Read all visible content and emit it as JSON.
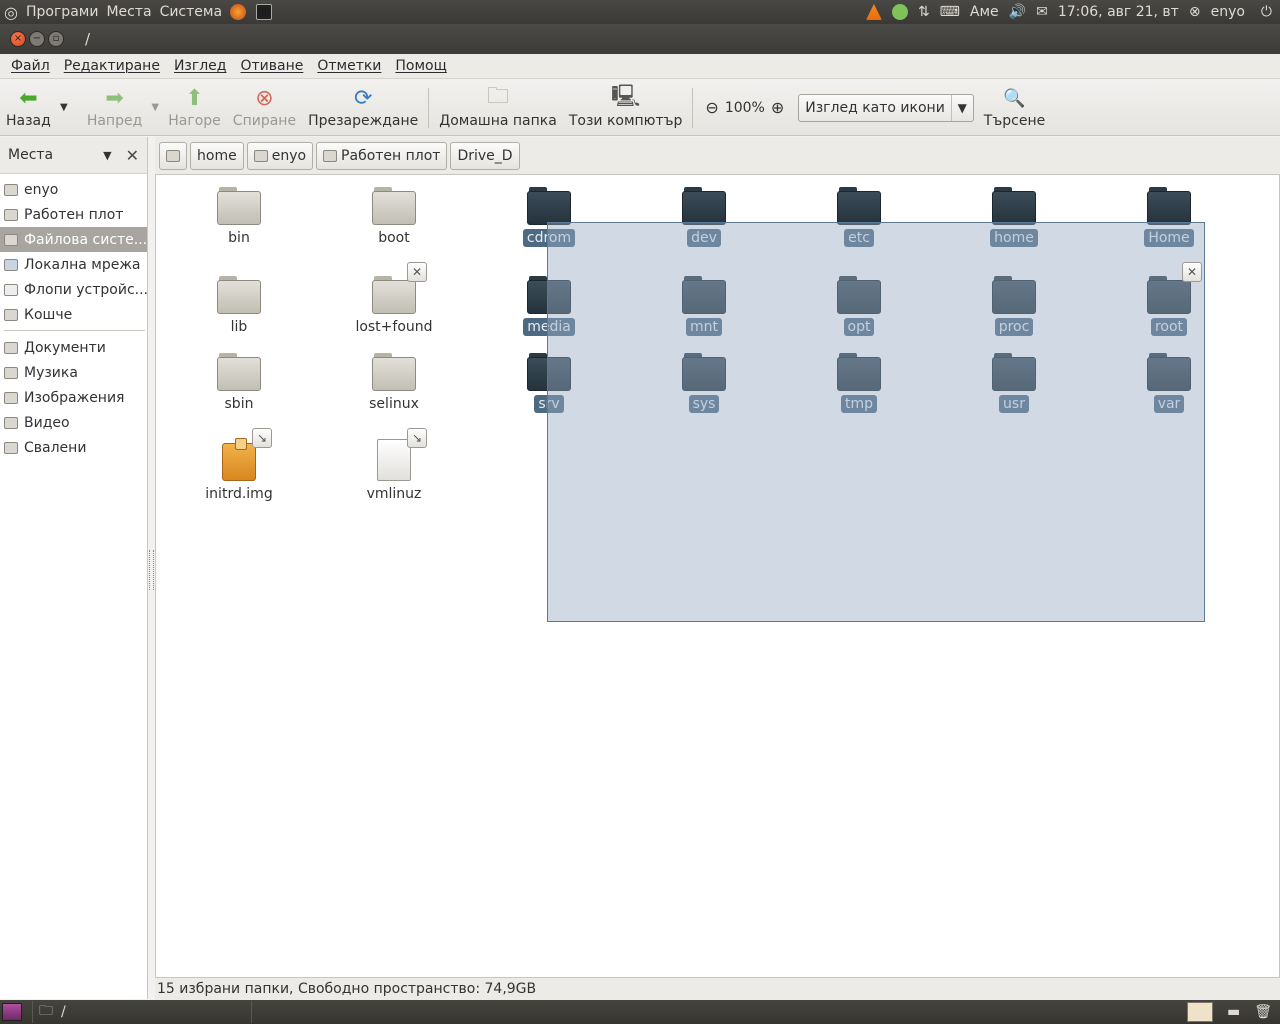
{
  "top_panel": {
    "menus": [
      "Програми",
      "Места",
      "Система"
    ],
    "keyboard": "Аме",
    "clock": "17:06, авг 21, вт",
    "user": "enyo"
  },
  "window": {
    "title": "/"
  },
  "menubar": [
    "Файл",
    "Редактиране",
    "Изглед",
    "Отиване",
    "Отметки",
    "Помощ"
  ],
  "toolbar": {
    "back": "Назад",
    "forward": "Напред",
    "up": "Нагоре",
    "stop": "Спиране",
    "reload": "Презареждане",
    "home": "Домашна папка",
    "computer": "Този компютър",
    "zoom": "100%",
    "view_mode": "Изглед като икони",
    "search": "Търсене"
  },
  "sidebar": {
    "header": "Места",
    "items": [
      "enyo",
      "Работен плот",
      "Файлова систе...",
      "Локална мрежа",
      "Флопи устройс...",
      "Кошче"
    ],
    "bookmarks": [
      "Документи",
      "Музика",
      "Изображения",
      "Видео",
      "Свалени"
    ]
  },
  "pathbar": [
    "home",
    "enyo",
    "Работен плот",
    "Drive_D"
  ],
  "files": {
    "unselected": [
      "bin",
      "boot",
      "lib",
      "lost+found",
      "sbin",
      "selinux",
      "initrd.img",
      "vmlinuz"
    ],
    "selected": [
      "cdrom",
      "dev",
      "etc",
      "home",
      "Home",
      "media",
      "mnt",
      "opt",
      "proc",
      "root",
      "srv",
      "sys",
      "tmp",
      "usr",
      "var"
    ]
  },
  "status": "15 избрани папки, Свободно пространство: 74,9GB",
  "bottom_panel": {
    "task": "/"
  },
  "colors": {
    "selection": "#4e6a82",
    "panel": "#3c3b37"
  }
}
